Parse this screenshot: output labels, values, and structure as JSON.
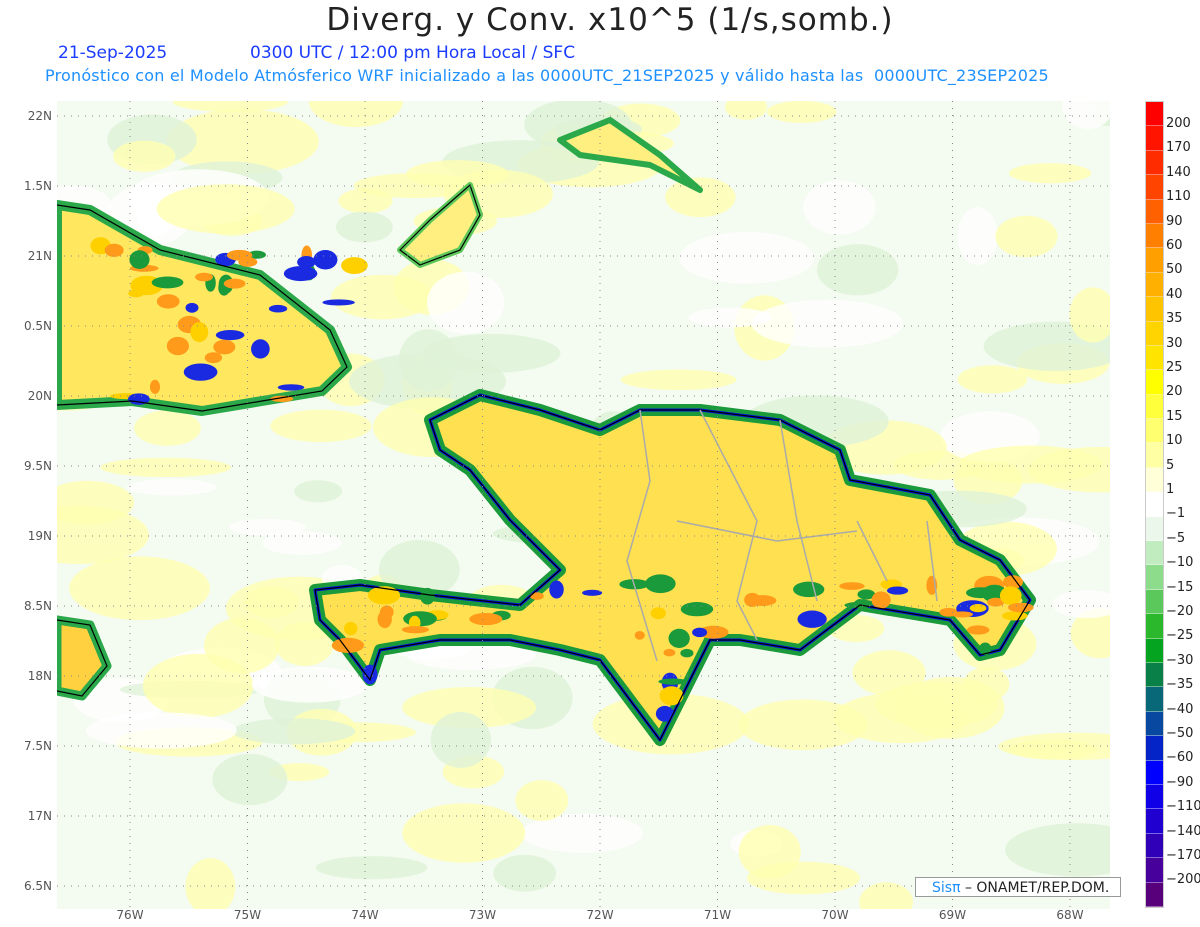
{
  "header": {
    "title": "Diverg. y Conv. x10^5 (1/s,somb.)",
    "date": "21-Sep-2025",
    "time": "0300 UTC / 12:00 pm Hora Local / SFC",
    "subtitle": "Pronóstico con el Modelo Atmósferico WRF inicializado a las 0000UTC_21SEP2025 y válido hasta las  0000UTC_23SEP2025"
  },
  "map": {
    "lat_labels": [
      "22N",
      "1.5N",
      "21N",
      "0.5N",
      "20N",
      "9.5N",
      "19N",
      "8.5N",
      "18N",
      "7.5N",
      "17N",
      "6.5N"
    ],
    "lon_labels": [
      "76W",
      "75W",
      "74W",
      "73W",
      "72W",
      "71W",
      "70W",
      "69W",
      "68W"
    ]
  },
  "colorbar": {
    "labels": [
      "200",
      "170",
      "140",
      "110",
      "90",
      "60",
      "50",
      "40",
      "35",
      "30",
      "25",
      "20",
      "15",
      "10",
      "5",
      "1",
      "−1",
      "−5",
      "−10",
      "−15",
      "−20",
      "−25",
      "−30",
      "−35",
      "−40",
      "−50",
      "−60",
      "−90",
      "−110",
      "−140",
      "−170",
      "−200"
    ],
    "colors": [
      "#ff0000",
      "#ff1400",
      "#ff2c00",
      "#ff4400",
      "#ff6000",
      "#ff8000",
      "#ffa000",
      "#ffb000",
      "#ffc400",
      "#ffd400",
      "#ffe400",
      "#ffff00",
      "#ffff3c",
      "#ffff70",
      "#ffffa4",
      "#ffffd8",
      "#ffffff",
      "#ebf7eb",
      "#c0ecc0",
      "#8cdc8c",
      "#5ac85a",
      "#2cb82c",
      "#04a420",
      "#088048",
      "#086878",
      "#0848a0",
      "#0424c8",
      "#0000ff",
      "#1000e8",
      "#2000d0",
      "#3000b8",
      "#48009c",
      "#58007c"
    ]
  },
  "credit": {
    "brand": "Sisπ",
    "text": " – ONAMET/REP.DOM."
  }
}
